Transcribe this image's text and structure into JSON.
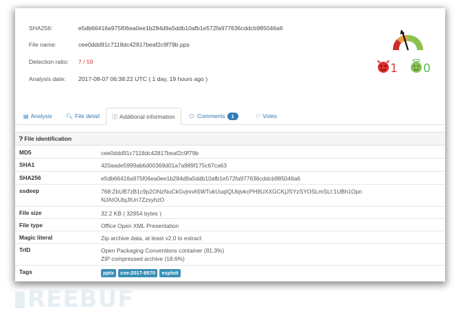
{
  "summary": {
    "sha256": {
      "label": "SHA256:",
      "value": "e5db66416a975f06ea0ee1b284d9a5ddb10afb1e572fa977636cddcb985046a6"
    },
    "file_name": {
      "label": "File name:",
      "value": "cee0ddd91c7118dc42817beaf2c9f79b.pps"
    },
    "detection_ratio": {
      "label": "Detection ratio:",
      "value": "7 / 59"
    },
    "analysis_date": {
      "label": "Analysis date:",
      "value": "2017-08-07 06:38:22 UTC ( 1 day, 19 hours ago )"
    }
  },
  "votes": {
    "malicious": "1",
    "harmless": "0",
    "malicious_color": "#d43f3a",
    "harmless_color": "#5cb85c"
  },
  "tabs": [
    {
      "label": "Analysis",
      "icon": "table-icon"
    },
    {
      "label": "File detail",
      "icon": "search-icon"
    },
    {
      "label": "Additional information",
      "icon": "info-icon",
      "active": true
    },
    {
      "label": "Comments",
      "icon": "comment-icon",
      "badge": "1"
    },
    {
      "label": "Votes",
      "icon": "vote-icon"
    }
  ],
  "section": {
    "title": "File identification",
    "icon": "question-icon"
  },
  "file_info": {
    "md5": {
      "label": "MD5",
      "value": "cee0ddd91c7118dc42817beaf2c9f79b"
    },
    "sha1": {
      "label": "SHA1",
      "value": "420aade5999ab6d00369d01a7a989f175c67ca63"
    },
    "sha256": {
      "label": "SHA256",
      "value": "e5db66416a975f06ea0ee1b284d9a5ddb10afb1e572fa977636cddcb985046a6"
    },
    "ssdeep": {
      "label": "ssdeep",
      "value1": "768:ZbUB7zB1c9p2ONzNuCkGvjnnA5WTukUuqIQUbjvkcPH9UXXGCKjJSYzSYOSLmSLI:1UBh1Opn",
      "value2": "NJAIOUbjJIUn7ZzsyhzO"
    },
    "file_size": {
      "label": "File size",
      "value": "32.2 KB ( 32954 bytes )"
    },
    "file_type": {
      "label": "File type",
      "value": "Office Open XML Presentation"
    },
    "magic": {
      "label": "Magic literal",
      "value": "Zip archive data, at least v2.0 to extract"
    },
    "trid": {
      "label": "TrID",
      "value1": "Open Packaging Conventions container (81.3%)",
      "value2": "ZIP compressed archive (18.6%)"
    },
    "tags": {
      "label": "Tags",
      "items": [
        "pptx",
        "cve-2017-8570",
        "exploit"
      ]
    }
  },
  "watermark": "REEBUF"
}
